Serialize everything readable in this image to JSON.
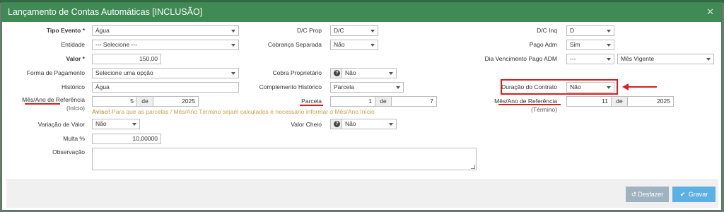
{
  "modal": {
    "title": "Lançamento de Contas Automáticas [INCLUSÃO]",
    "close_glyph": "✕"
  },
  "fields": {
    "tipo_evento": {
      "label": "Tipo Evento *",
      "value": "Água"
    },
    "entidade": {
      "label": "Entidade",
      "value": "--- Selecione ---"
    },
    "valor": {
      "label": "Valor *",
      "value": "150,00"
    },
    "forma_pagamento": {
      "label": "Forma de Pagamento",
      "value": "Selecione uma opção"
    },
    "historico": {
      "label": "Histórico",
      "value": "Água"
    },
    "mes_ano_ref_inicio": {
      "label": "Mês/Ano de Referência",
      "sub": "(Início)",
      "mes": "5",
      "sep": "de",
      "ano": "2025"
    },
    "variacao_valor": {
      "label": "Variação de Valor",
      "value": "Não"
    },
    "multa": {
      "label": "Multa %",
      "value": "10,00000"
    },
    "observacao": {
      "label": "Observação",
      "value": ""
    },
    "dc_prop": {
      "label": "D/C Prop",
      "value": "D/C"
    },
    "cobranca_separada": {
      "label": "Cobrança Separada",
      "value": "Não"
    },
    "cobra_proprietario": {
      "label": "Cobra Proprietário",
      "value": "Não"
    },
    "complemento_historico": {
      "label": "Complemento Histórico",
      "value": "Parcela"
    },
    "parcela": {
      "label": "Parcela",
      "num": "1",
      "sep": "de",
      "total": "7"
    },
    "valor_cheio": {
      "label": "Valor Cheio",
      "value": "Não"
    },
    "dc_inq": {
      "label": "D/C Inq",
      "value": "D"
    },
    "pago_adm": {
      "label": "Pago Adm",
      "value": "Sim"
    },
    "dia_vencimento": {
      "label": "Dia Vencimento Pago ADM",
      "value": "---",
      "mes_value": "Mês Vigente"
    },
    "duracao_contrato": {
      "label": "Duração do Contrato",
      "value": "Não"
    },
    "mes_ano_ref_termino": {
      "label": "Mês/Ano de Referência",
      "sub": "(Término)",
      "mes": "11",
      "sep": "de",
      "ano": "2025"
    }
  },
  "warning": {
    "prefix": "Aviso!",
    "text": " Para que as parcelas / Mês/Ano Término sejam calculados é necessário informar o Mês/Ano Início"
  },
  "help_glyph": "?",
  "footer": {
    "undo_label": "Desfazer",
    "save_label": "Gravar",
    "undo_icon": "↺",
    "save_icon": "✔"
  },
  "colors": {
    "header": "#3f8a55",
    "annotation": "#d62020",
    "save_button": "#5cb0e3",
    "undo_button": "#9fb2bf",
    "warning": "#c8a04a"
  }
}
